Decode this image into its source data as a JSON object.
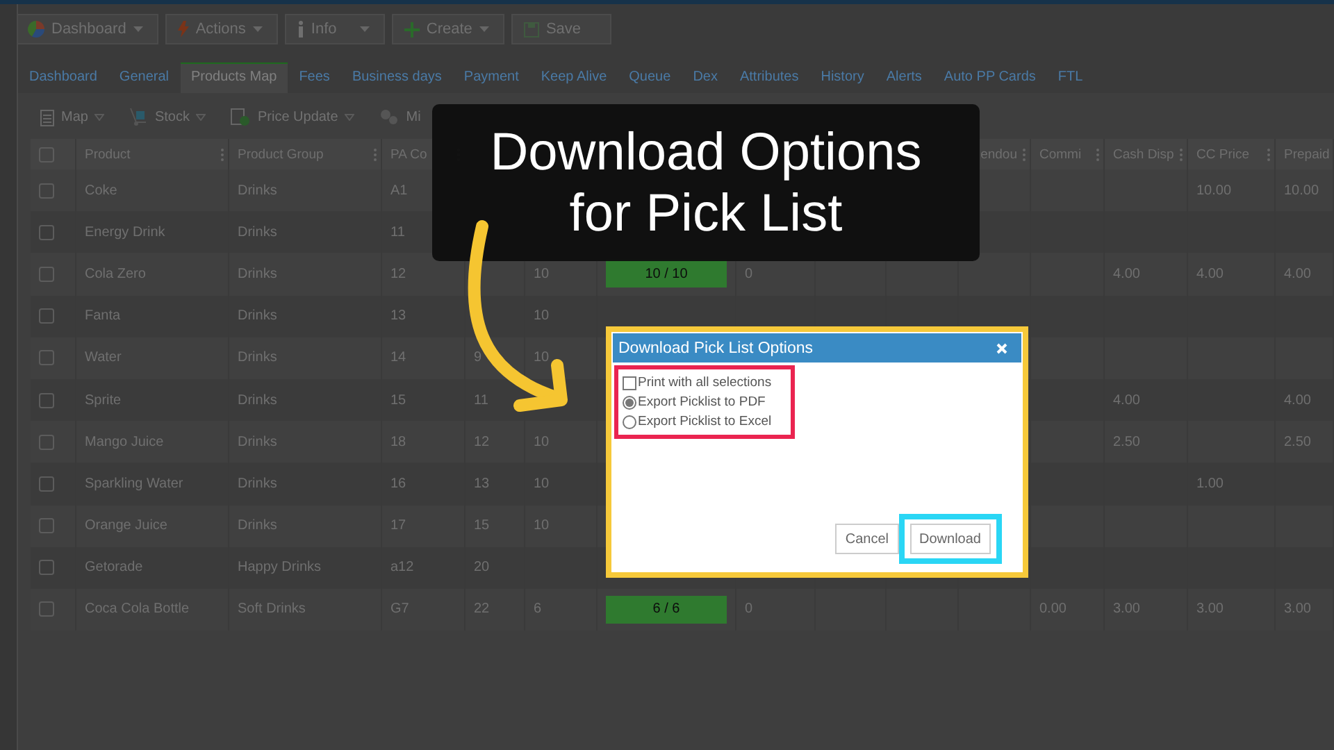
{
  "toolbar": [
    {
      "label": "Dashboard",
      "dropdown": true
    },
    {
      "label": "Actions",
      "dropdown": true
    },
    {
      "label": "Info",
      "dropdown": true
    },
    {
      "label": "Create",
      "dropdown": true
    },
    {
      "label": "Save",
      "dropdown": false
    }
  ],
  "tabs": [
    {
      "label": "Dashboard",
      "selected": false
    },
    {
      "label": "General",
      "selected": false
    },
    {
      "label": "Products Map",
      "selected": true
    },
    {
      "label": "Fees",
      "selected": false
    },
    {
      "label": "Business days",
      "selected": false
    },
    {
      "label": "Payment",
      "selected": false
    },
    {
      "label": "Keep Alive",
      "selected": false
    },
    {
      "label": "Queue",
      "selected": false
    },
    {
      "label": "Dex",
      "selected": false
    },
    {
      "label": "Attributes",
      "selected": false
    },
    {
      "label": "History",
      "selected": false
    },
    {
      "label": "Alerts",
      "selected": false
    },
    {
      "label": "Auto PP Cards",
      "selected": false
    },
    {
      "label": "FTL",
      "selected": false
    }
  ],
  "sub_toolbar": [
    {
      "label": "Map"
    },
    {
      "label": "Stock"
    },
    {
      "label": "Price Update"
    },
    {
      "label": "Mi"
    }
  ],
  "table": {
    "select_all_checked": false,
    "columns": [
      "Product",
      "Product Group",
      "PA Co",
      null,
      null,
      null,
      null,
      null,
      null,
      "endou",
      "Commi",
      "Cash Disp",
      "CC Price",
      "Prepaid"
    ],
    "rows": [
      {
        "checked": false,
        "cells": [
          "Coke",
          "Drinks",
          "A1",
          null,
          null,
          null,
          null,
          null,
          null,
          null,
          null,
          null,
          "10.00",
          "10.00"
        ]
      },
      {
        "checked": false,
        "cells": [
          "Energy Drink",
          "Drinks",
          "11",
          null,
          null,
          null,
          null,
          null,
          null,
          null,
          null,
          null,
          null,
          null
        ]
      },
      {
        "checked": false,
        "cells": [
          "Cola Zero",
          "Drinks",
          "12",
          null,
          "10",
          {
            "text": "10 / 10",
            "kind": "full"
          },
          "0",
          null,
          null,
          null,
          null,
          "4.00",
          "4.00",
          "4.00"
        ]
      },
      {
        "checked": false,
        "cells": [
          "Fanta",
          "Drinks",
          "13",
          null,
          "10",
          null,
          null,
          null,
          null,
          null,
          null,
          null,
          null,
          null
        ]
      },
      {
        "checked": false,
        "cells": [
          "Water",
          "Drinks",
          "14",
          "9",
          "10",
          null,
          null,
          null,
          null,
          null,
          null,
          null,
          null,
          null
        ]
      },
      {
        "checked": false,
        "cells": [
          "Sprite",
          "Drinks",
          "15",
          "11",
          null,
          null,
          null,
          null,
          null,
          null,
          null,
          "4.00",
          null,
          "4.00"
        ]
      },
      {
        "checked": false,
        "cells": [
          "Mango Juice",
          "Drinks",
          "18",
          "12",
          "10",
          null,
          null,
          null,
          null,
          null,
          null,
          "2.50",
          null,
          "2.50"
        ]
      },
      {
        "checked": false,
        "cells": [
          "Sparkling Water",
          "Drinks",
          "16",
          "13",
          "10",
          null,
          null,
          null,
          null,
          null,
          null,
          null,
          "1.00",
          null
        ]
      },
      {
        "checked": false,
        "cells": [
          "Orange Juice",
          "Drinks",
          "17",
          "15",
          "10",
          null,
          null,
          null,
          null,
          null,
          null,
          null,
          null,
          null
        ]
      },
      {
        "checked": false,
        "cells": [
          "Getorade",
          "Happy Drinks",
          "a12",
          "20",
          null,
          null,
          null,
          null,
          null,
          null,
          null,
          null,
          null,
          null
        ]
      },
      {
        "checked": false,
        "cells": [
          "Coca Cola Bottle",
          "Soft Drinks",
          "G7",
          "22",
          "6",
          {
            "text": "6 / 6",
            "kind": "full"
          },
          "0",
          null,
          null,
          null,
          "0.00",
          "3.00",
          "3.00",
          "3.00"
        ]
      }
    ]
  },
  "caption": {
    "lines": [
      "Download Options",
      "for Pick List"
    ]
  },
  "dialog": {
    "title": "Download Pick List Options",
    "checkbox": {
      "label": "Print with all selections",
      "checked": false
    },
    "options": [
      {
        "label": "Export Picklist to PDF",
        "selected": true
      },
      {
        "label": "Export Picklist to Excel",
        "selected": false
      }
    ],
    "buttons": [
      {
        "label": "Cancel",
        "kind": "plain"
      },
      {
        "label": "Download",
        "kind": "highlighted"
      }
    ]
  }
}
